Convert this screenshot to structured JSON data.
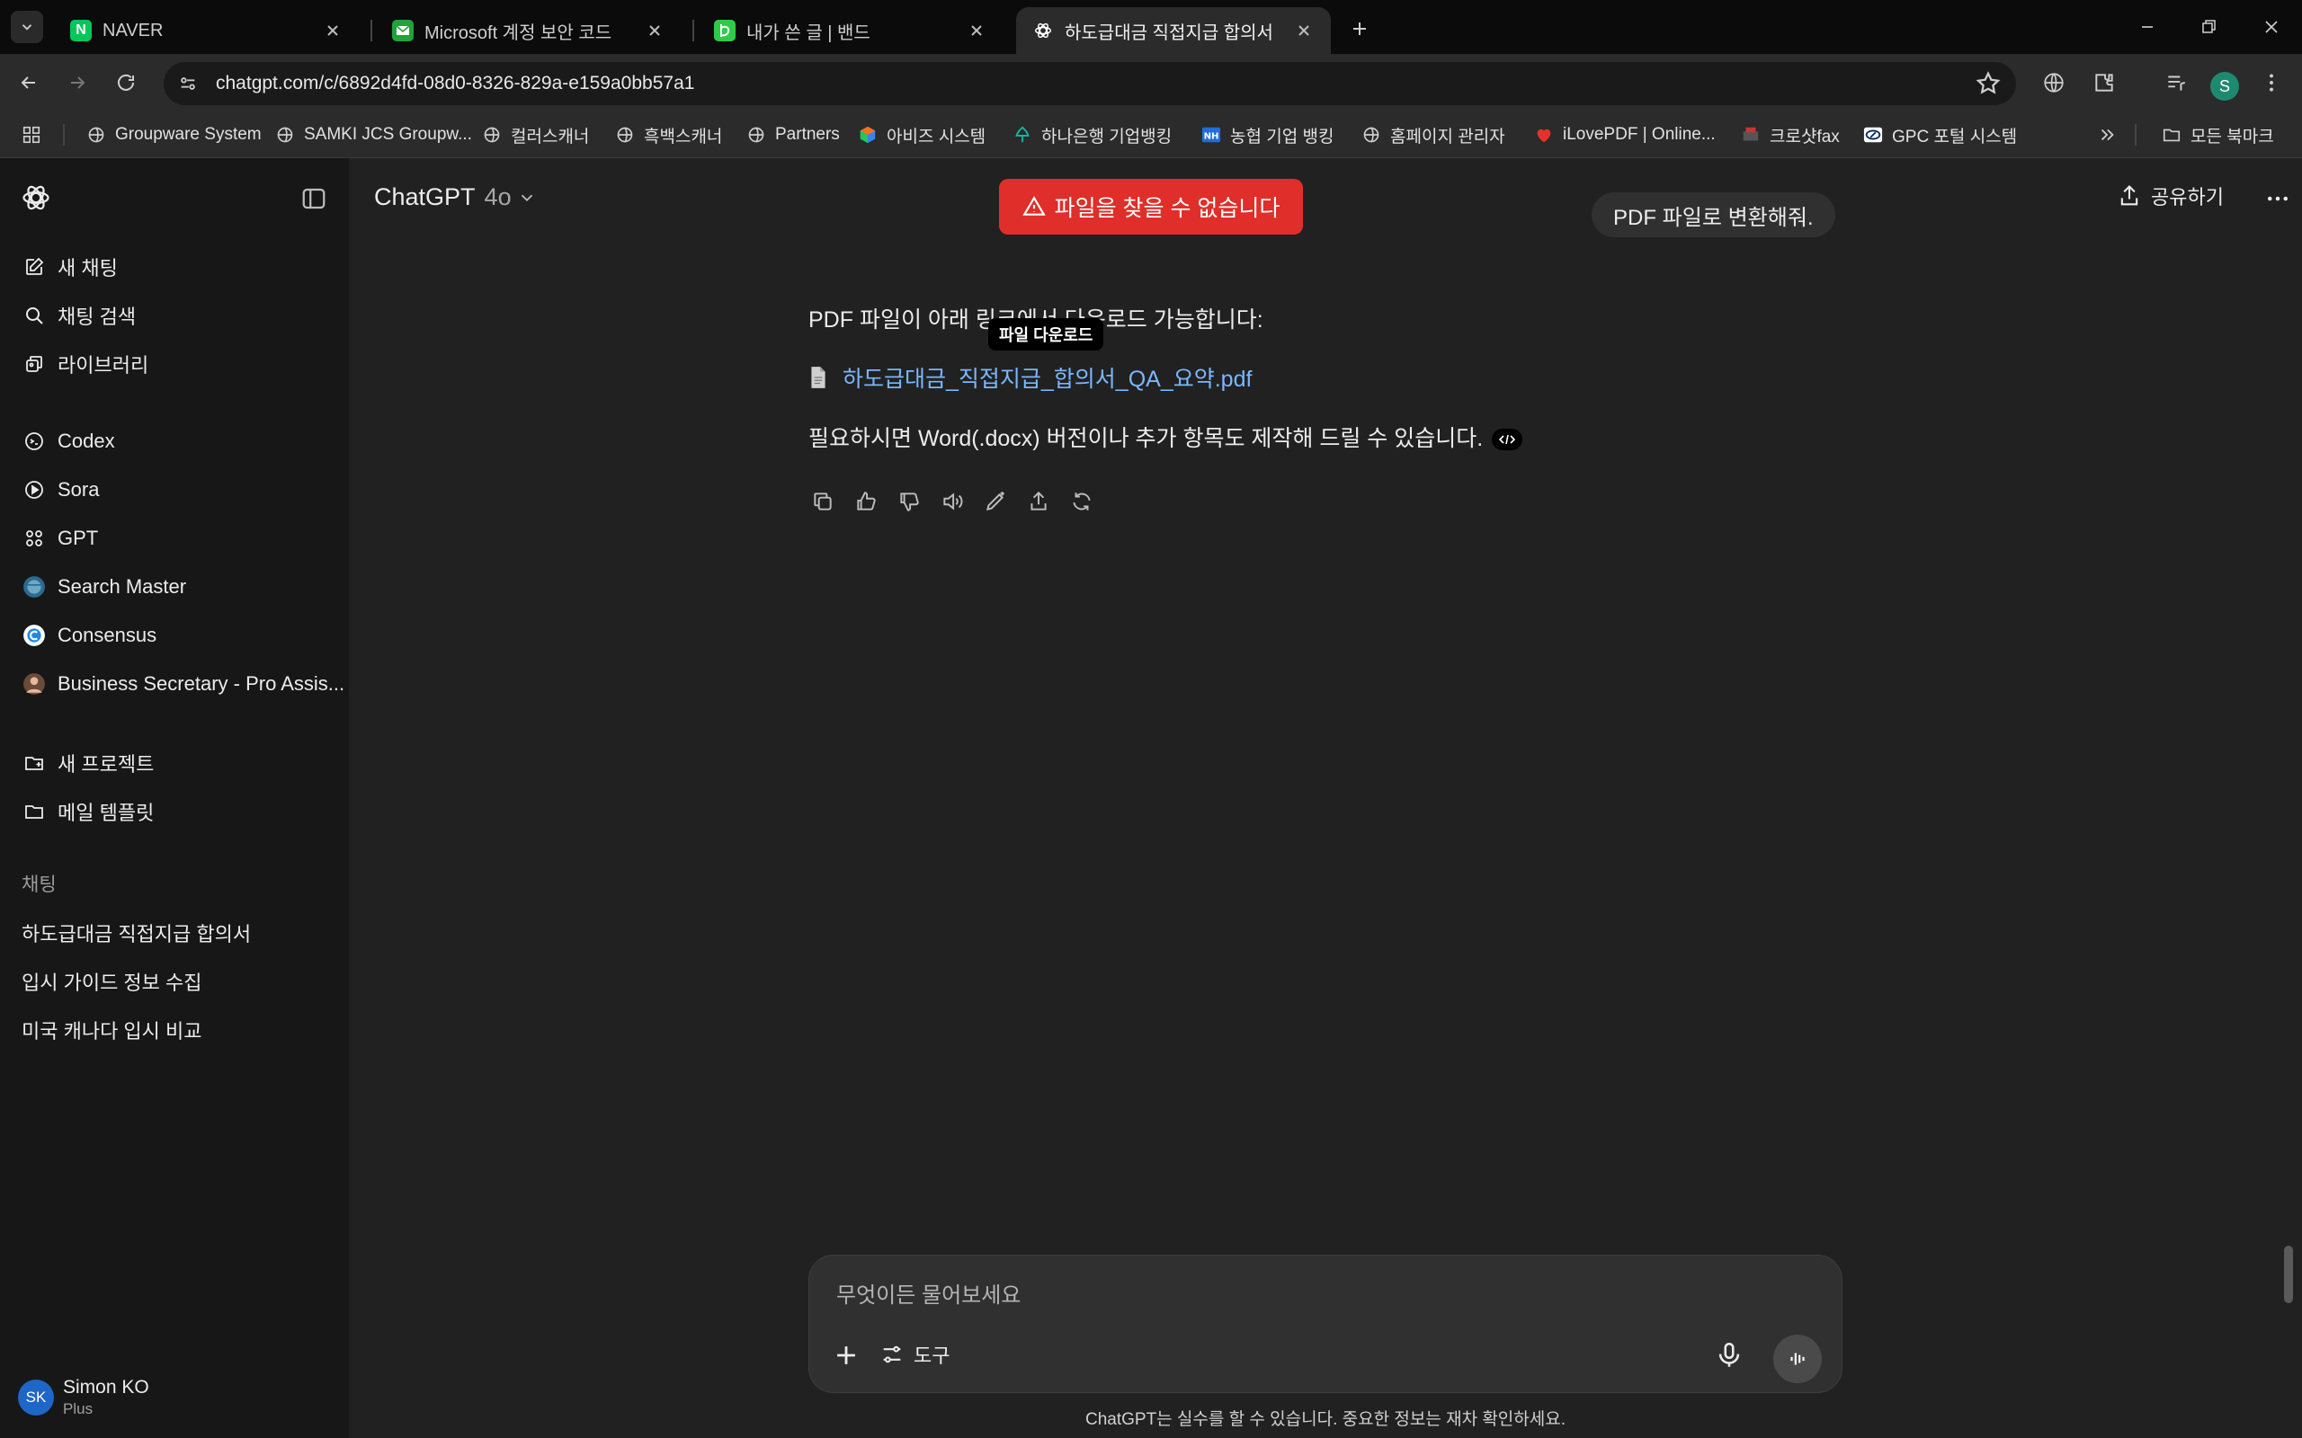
{
  "browser": {
    "tabs": [
      {
        "title": "NAVER",
        "favicon": "N",
        "favicon_color": "#03c75a"
      },
      {
        "title": "Microsoft 계정 보안 코드",
        "favicon": "mail-icon",
        "favicon_color": "#1fa33a"
      },
      {
        "title": "내가 쓴 글 | 밴드",
        "favicon": "band-icon",
        "favicon_color": "#2fcb48"
      },
      {
        "title": "하도급대금 직접지급 합의서",
        "favicon": "openai-icon",
        "favicon_color": "#ffffff"
      }
    ],
    "url": "chatgpt.com/c/6892d4fd-08d0-8326-829a-e159a0bb57a1",
    "profile_initial": "S",
    "bookmarks": [
      "Groupware System",
      "SAMKI JCS Groupw...",
      "컬러스캐너",
      "흑백스캐너",
      "Partners",
      "아비즈 시스템",
      "하나은행 기업뱅킹",
      "농협 기업 뱅킹",
      "홈페이지 관리자",
      "iLovePDF | Online...",
      "크로샷fax",
      "GPC 포털 시스템"
    ],
    "all_bookmarks": "모든 북마크"
  },
  "sidebar": {
    "primary": [
      {
        "label": "새 채팅",
        "icon": "compose-icon"
      },
      {
        "label": "채팅 검색",
        "icon": "search-icon"
      },
      {
        "label": "라이브러리",
        "icon": "library-icon"
      }
    ],
    "apps": [
      {
        "label": "Codex",
        "icon": "codex-icon"
      },
      {
        "label": "Sora",
        "icon": "sora-icon"
      },
      {
        "label": "GPT",
        "icon": "gpt-grid-icon"
      },
      {
        "label": "Search Master",
        "icon": "globe-avatar-icon"
      },
      {
        "label": "Consensus",
        "icon": "consensus-icon"
      },
      {
        "label": "Business Secretary - Pro Assis...",
        "icon": "person-avatar-icon"
      }
    ],
    "projects": [
      {
        "label": "새 프로젝트",
        "icon": "new-folder-icon"
      },
      {
        "label": "메일 템플릿",
        "icon": "folder-icon"
      }
    ],
    "chats_label": "채팅",
    "chats": [
      "하도급대금 직접지급 합의서",
      "입시 가이드 정보 수집",
      "미국 캐나다 입시 비교"
    ],
    "user": {
      "initials": "SK",
      "name": "Simon KO",
      "plan": "Plus"
    }
  },
  "main": {
    "model_name": "ChatGPT",
    "model_version": "4o",
    "share_label": "공유하기",
    "error_toast": "파일을 찾을 수 없습니다",
    "user_message": "PDF 파일로 변환해줘.",
    "assistant": {
      "line1": "PDF 파일이 아래 링크에서 다운로드 가능합니다:",
      "file_link": "하도급대금_직접지급_합의서_QA_요약.pdf",
      "tooltip": "파일 다운로드",
      "line2": "필요하시면 Word(.docx) 버전이나 추가 항목도 제작해 드릴 수 있습니다."
    },
    "composer": {
      "placeholder": "무엇이든 물어보세요",
      "tools_label": "도구"
    },
    "disclaimer": "ChatGPT는 실수를 할 수 있습니다. 중요한 정보는 재차 확인하세요."
  },
  "colors": {
    "error": "#e02e2a",
    "link": "#7ab7ff",
    "sidebar_bg": "#171717",
    "main_bg": "#212121"
  }
}
